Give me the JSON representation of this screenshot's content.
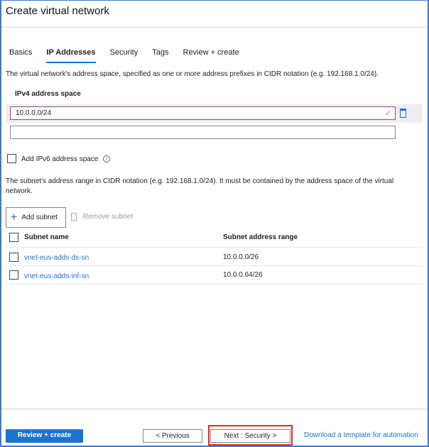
{
  "title": "Create virtual network",
  "tabs": [
    "Basics",
    "IP Addresses",
    "Security",
    "Tags",
    "Review + create"
  ],
  "address_desc": "The virtual network's address space, specified as one or more address prefixes in CIDR notation (e.g. 192.168.1.0/24).",
  "ipv4_label": "IPv4 address space",
  "ipv4_value": "10.0.0.0/24",
  "ipv4_new_value": "",
  "ipv6_label": "Add IPv6 address space",
  "subnet_desc": "The subnet's address range in CIDR notation (e.g. 192.168.1.0/24). It must be contained by the address space of the virtual network.",
  "add_subnet": "Add subnet",
  "remove_subnet": "Remove subnet",
  "columns": [
    "Subnet name",
    "Subnet address range"
  ],
  "subnets": [
    {
      "name": "vnet-eus-adds-ds-sn",
      "range": "10.0.0.0/26"
    },
    {
      "name": "vnet-eus-adds-inf-sn",
      "range": "10.0.0.64/26"
    }
  ],
  "footer": {
    "review": "Review + create",
    "previous": "< Previous",
    "next": "Next : Security >",
    "download": "Download a template for automation"
  },
  "colors": {
    "accent": "#1a73d2",
    "focus": "#9b3bb5",
    "highlight": "#e03020"
  }
}
